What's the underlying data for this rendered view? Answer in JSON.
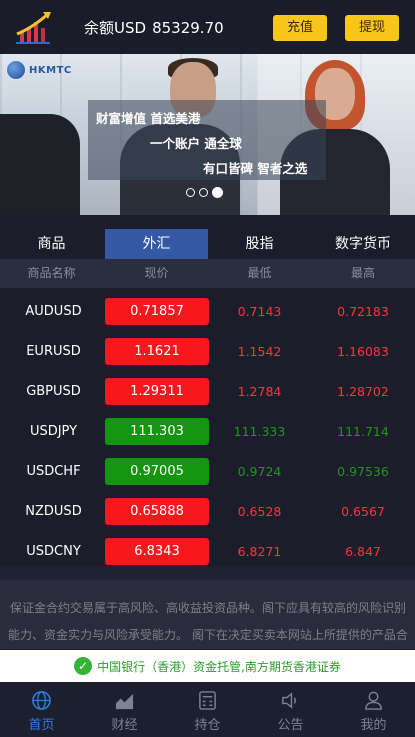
{
  "header": {
    "balance_label": "余额USD",
    "balance_value": "85329.70",
    "recharge_label": "充值",
    "withdraw_label": "提现"
  },
  "banner": {
    "brand": "HKMTC",
    "slogans": [
      "财富增值 首选美港",
      "一个账户 通全球",
      "有口皆碑 智者之选"
    ],
    "slides": 3,
    "active_slide": 3
  },
  "tabs": [
    {
      "label": "商品",
      "active": false
    },
    {
      "label": "外汇",
      "active": true
    },
    {
      "label": "股指",
      "active": false
    },
    {
      "label": "数字货币",
      "active": false
    }
  ],
  "columns": [
    "商品名称",
    "现价",
    "最低",
    "最高"
  ],
  "rows": [
    {
      "symbol": "AUDUSD",
      "price": "0.71857",
      "low": "0.7143",
      "high": "0.72183",
      "trend": "up"
    },
    {
      "symbol": "EURUSD",
      "price": "1.1621",
      "low": "1.1542",
      "high": "1.16083",
      "trend": "up"
    },
    {
      "symbol": "GBPUSD",
      "price": "1.29311",
      "low": "1.2784",
      "high": "1.28702",
      "trend": "up"
    },
    {
      "symbol": "USDJPY",
      "price": "111.303",
      "low": "111.333",
      "high": "111.714",
      "trend": "down"
    },
    {
      "symbol": "USDCHF",
      "price": "0.97005",
      "low": "0.9724",
      "high": "0.97536",
      "trend": "down"
    },
    {
      "symbol": "NZDUSD",
      "price": "0.65888",
      "low": "0.6528",
      "high": "0.6567",
      "trend": "up"
    },
    {
      "symbol": "USDCNY",
      "price": "6.8343",
      "low": "6.8271",
      "high": "6.847",
      "trend": "up"
    }
  ],
  "disclaimer": "保证金合约交易属于高风险、高收益投资品种。阁下应具有较高的风险识别能力、资金实力与风险承受能力。 阁下在决定买卖本网站上所提供的产品合",
  "custody": "中国银行（香港）资金托管,南方期货香港证券",
  "nav": [
    {
      "label": "首页",
      "icon": "globe-icon",
      "active": true
    },
    {
      "label": "财经",
      "icon": "chart-icon",
      "active": false
    },
    {
      "label": "持仓",
      "icon": "calculator-icon",
      "active": false
    },
    {
      "label": "公告",
      "icon": "speaker-icon",
      "active": false
    },
    {
      "label": "我的",
      "icon": "user-icon",
      "active": false
    }
  ],
  "colors": {
    "up": "#f6181d",
    "down": "#13950f",
    "accent": "#3558a4",
    "button": "#f6c619",
    "nav_active": "#2f7de1"
  }
}
